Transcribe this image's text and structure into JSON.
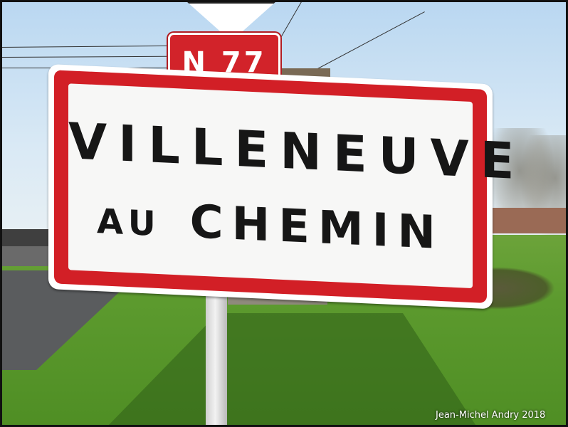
{
  "route_sign": {
    "number": "N 77"
  },
  "town_sign": {
    "line1": "VILLENEUVE",
    "line2_small": "AU",
    "line2_large": "CHEMIN"
  },
  "credit": {
    "text": "Jean-Michel Andry 2018"
  },
  "colors": {
    "sign_red": "#d21f26",
    "sign_white": "#f7f7f6",
    "text": "#161616",
    "grass": "#5c9a2e",
    "sky": "#b9d7f1"
  }
}
